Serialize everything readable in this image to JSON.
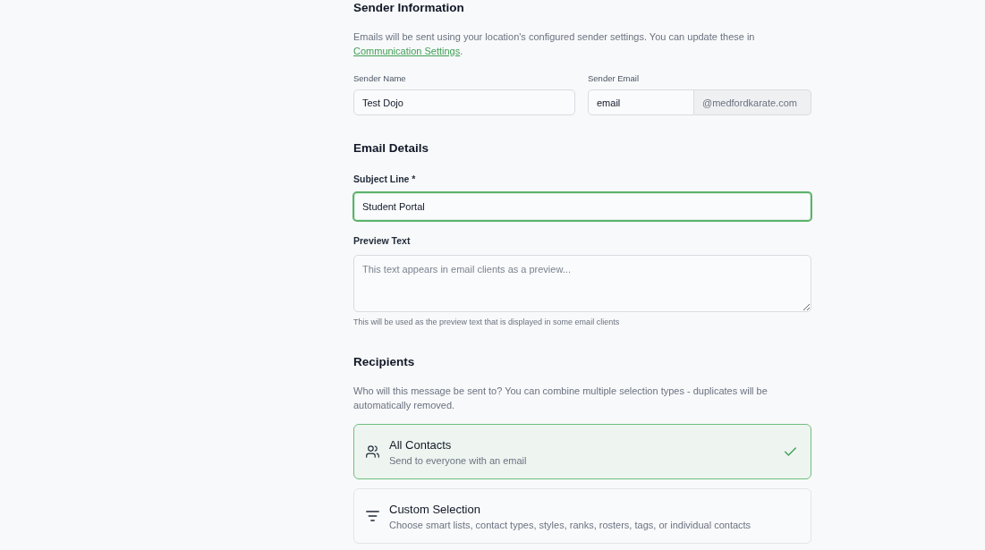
{
  "sender_information": {
    "heading": "Sender Information",
    "description": "Emails will be sent using your location's configured sender settings. You can update these in",
    "link": "Communication Settings",
    "description_end": ".",
    "sender_name": {
      "label": "Sender Name",
      "value": "Test Dojo"
    },
    "sender_email": {
      "label": "Sender Email",
      "value": "email",
      "domain": "@medfordkarate.com"
    }
  },
  "email_details": {
    "heading": "Email Details",
    "subject": {
      "label": "Subject Line *",
      "value": "Student Portal",
      "focused": true
    },
    "preview_text": {
      "label": "Preview Text",
      "placeholder": "This text appears in email clients as a preview...",
      "help": "This will be used as the preview text that is displayed in some email clients"
    }
  },
  "recipients": {
    "heading": "Recipients",
    "description": "Who will this message be sent to? You can combine multiple selection types - duplicates will be automatically removed.",
    "options": [
      {
        "kind": "all",
        "title": "All Contacts",
        "subtitle": "Send to everyone with an email",
        "selected": true
      },
      {
        "kind": "custom",
        "title": "Custom Selection",
        "subtitle": "Choose smart lists, contact types, styles, ranks, rosters, tags, or individual contacts",
        "selected": false
      }
    ]
  }
}
